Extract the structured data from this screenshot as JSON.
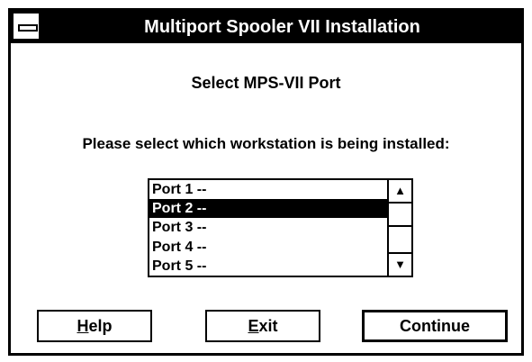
{
  "window": {
    "title": "Multiport Spooler VII Installation"
  },
  "heading": "Select MPS-VII Port",
  "prompt": "Please select which workstation is being installed:",
  "ports": [
    {
      "label": "Port 1 --"
    },
    {
      "label": "Port 2 --"
    },
    {
      "label": "Port 3 --"
    },
    {
      "label": "Port 4 --"
    },
    {
      "label": "Port 5 --"
    }
  ],
  "selected_port": "Port 2 --",
  "buttons": {
    "help_mnemonic": "H",
    "help_rest": "elp",
    "exit_mnemonic": "E",
    "exit_rest": "xit",
    "continue": "Continue"
  },
  "icons": {
    "scroll_up": "up-arrow-icon",
    "scroll_down": "down-arrow-icon",
    "system_menu": "system-menu-icon"
  }
}
